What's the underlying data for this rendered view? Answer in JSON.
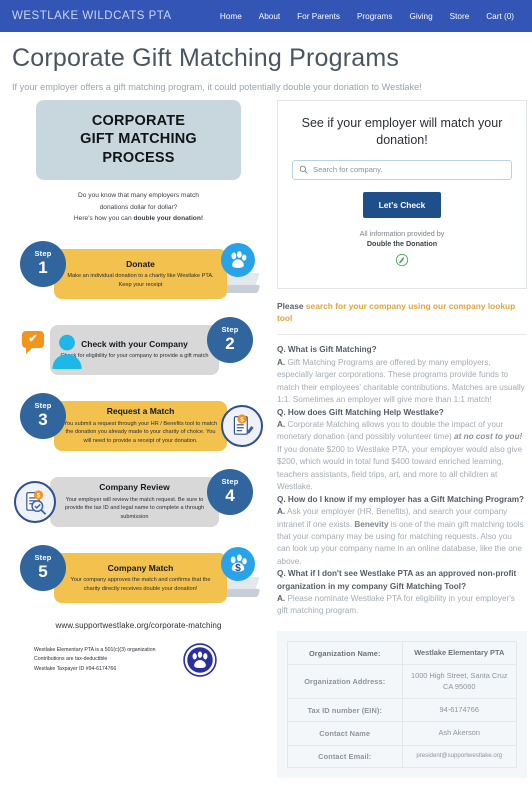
{
  "nav": {
    "brand": "WESTLAKE WILDCATS PTA",
    "links": [
      {
        "label": "Home"
      },
      {
        "label": "About"
      },
      {
        "label": "For Parents"
      },
      {
        "label": "Programs"
      },
      {
        "label": "Giving"
      },
      {
        "label": "Store"
      },
      {
        "label": "Cart (0)"
      }
    ],
    "bg_color": "#3355b5"
  },
  "header": {
    "title": "Corporate Gift Matching Programs",
    "subtitle": "If your employer offers a gift matching program, it could potentially double your donation to Westlake!"
  },
  "infographic": {
    "heading_line1": "CORPORATE",
    "heading_line2": "GIFT MATCHING",
    "heading_line3": "PROCESS",
    "heading_bg": "#c8d7dd",
    "intro_line1": "Do you know that many employers match",
    "intro_line2": "donations dollar for dollar?",
    "intro_line3_pre": "Here's how you can ",
    "intro_line3_bold": "double your donation!",
    "step_label": "Step",
    "steps": [
      {
        "number": "1",
        "title": "Donate",
        "body": "Make an individual donation to a charity like Westlake PTA. Keep your receipt",
        "card_color": "#f2c14e",
        "icon": "paw-pedestal-icon"
      },
      {
        "number": "2",
        "title": "Check with your Company",
        "body": "Check for eligibility for your company to provide a gift match",
        "card_color": "#d8d8d8",
        "icon": "person-check-icon"
      },
      {
        "number": "3",
        "title": "Request a Match",
        "body": "You submit a request through your HR / Benefits tool to match the donation you already made to your charity of choice. You will need to provide a receipt of your donation.",
        "card_color": "#f2c14e",
        "icon": "document-pencil-dollar-icon"
      },
      {
        "number": "4",
        "title": "Company Review",
        "body": "Your employer will review the match request. Be sure to provide the tax ID and legal name to complete a through submission",
        "card_color": "#d8d8d8",
        "icon": "document-magnifier-dollar-icon"
      },
      {
        "number": "5",
        "title": "Company Match",
        "body": "Your company approves the match and confirms that the charity directly receives double your donation!",
        "card_color": "#f2c14e",
        "icon": "paw-dollar-pedestal-icon"
      }
    ],
    "url": "www.supportwestlake.org/corporate-matching",
    "footer_line1": "Westlake Elementary PTA is a 501(c)(3) organization",
    "footer_line2": "Contributions are tax-deductible",
    "footer_line3": "Westlake Taxpayer ID #94-6174766"
  },
  "search": {
    "heading": "See if your employer will match your donation!",
    "placeholder": "Search for company.",
    "value": "",
    "button_label": "Let's Check",
    "provided_by": "All information provided by",
    "provider": "Double the Donation",
    "button_color": "#1e4f8a"
  },
  "lookup": {
    "prefix": "Please ",
    "link": "search for your company using our company lookup tool"
  },
  "faq": [
    {
      "q": "Q. What is Gift Matching?",
      "a_lead": "A.",
      "a": " Gift Matching Programs are offered by many employers, especially larger corporations. These programs provide funds to match their employees' charitable contributions. Matches are usually 1:1. Sometimes an employer will give more than 1:1 match!"
    },
    {
      "q": "Q. How does Gift Matching Help Westlake?",
      "a_lead": "A.",
      "a_part1": " Corporate Matching allows you to double the impact of your monetary donation (and possibly volunteer time) ",
      "a_em": "at no cost to you!",
      "a_part2": " If you donate $200 to Westlake PTA, your employer would also give $200, which would in total fund $400 toward enriched learning, teachers assistants, field trips, art, and more to all children at Westlake."
    },
    {
      "q": "Q. How do I know if my employer has a Gift Matching Program?",
      "a_lead": "A.",
      "a_part1": " Ask your employer (HR, Benefits), and search your company intranet if one exists. ",
      "a_em": "Benevity",
      "a_part2": " is one of the main gift matching tools that your company may be using for matching requests. Also you can look up your company name in an online database, like the one above."
    },
    {
      "q": "Q. What if I don't see Westlake PTA as an approved non-profit organization in my company Gift Matching Tool?",
      "a_lead": "A.",
      "a": " Please nominate Westlake PTA for eligibility in your employer's gift matching program."
    }
  ],
  "org_table": {
    "rows": [
      {
        "key": "Organization Name:",
        "value": "Westlake Elementary PTA"
      },
      {
        "key": "Organization Address:",
        "value": "1000 High Street, Santa Cruz CA 95060"
      },
      {
        "key": "Tax ID number (EIN):",
        "value": "94-6174766"
      },
      {
        "key": "Contact Name",
        "value": "Ash Akerson"
      },
      {
        "key": "Contact Email:",
        "value": "president@supportwestlake.org"
      }
    ]
  }
}
